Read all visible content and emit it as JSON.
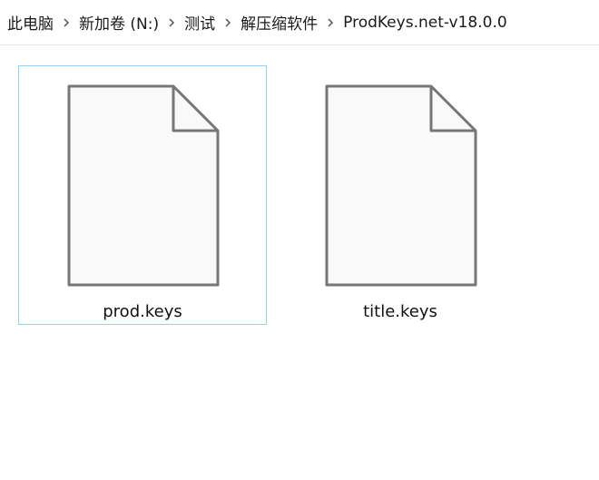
{
  "breadcrumb": {
    "items": [
      {
        "label": "此电脑"
      },
      {
        "label": "新加卷 (N:)"
      },
      {
        "label": "测试"
      },
      {
        "label": "解压缩软件"
      },
      {
        "label": "ProdKeys.net-v18.0.0"
      }
    ]
  },
  "files": [
    {
      "name": "prod.keys",
      "icon": "generic-file-icon",
      "selected": true
    },
    {
      "name": "title.keys",
      "icon": "generic-file-icon",
      "selected": false
    }
  ],
  "colors": {
    "selection_border": "#99d1f0",
    "icon_stroke": "#777777",
    "icon_fill": "#f9f9f9"
  }
}
